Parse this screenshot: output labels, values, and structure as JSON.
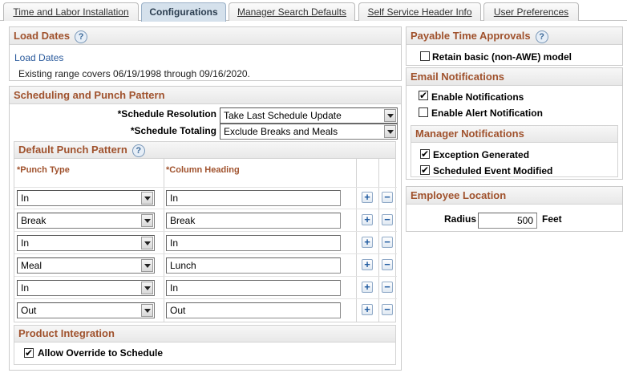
{
  "tabs": [
    {
      "label": "Time and Labor Installation",
      "active": false
    },
    {
      "label": "Configurations",
      "active": true
    },
    {
      "label": "Manager Search Defaults",
      "active": false
    },
    {
      "label": "Self Service Header Info",
      "active": false
    },
    {
      "label": "User Preferences",
      "active": false
    }
  ],
  "load_dates": {
    "title": "Load Dates",
    "link": "Load Dates",
    "range_text": "Existing range covers 06/19/1998 through 09/16/2020."
  },
  "scheduling": {
    "title": "Scheduling and Punch Pattern",
    "resolution_label": "*Schedule Resolution",
    "resolution_value": "Take Last Schedule Update",
    "totaling_label": "*Schedule Totaling",
    "totaling_value": "Exclude Breaks and Meals"
  },
  "punch_pattern": {
    "title": "Default Punch Pattern",
    "col_punch_type": "*Punch Type",
    "col_heading": "*Column Heading",
    "rows": [
      {
        "type": "In",
        "heading": "In"
      },
      {
        "type": "Break",
        "heading": "Break"
      },
      {
        "type": "In",
        "heading": "In"
      },
      {
        "type": "Meal",
        "heading": "Lunch"
      },
      {
        "type": "In",
        "heading": "In"
      },
      {
        "type": "Out",
        "heading": "Out"
      }
    ],
    "add_symbol": "+",
    "delete_symbol": "−"
  },
  "product_integration": {
    "title": "Product Integration",
    "allow_override_label": "Allow Override to Schedule",
    "allow_override_checked": true
  },
  "payable_time": {
    "title": "Payable Time Approvals",
    "retain_label": "Retain basic (non-AWE) model",
    "retain_checked": false
  },
  "email_notifications": {
    "title": "Email Notifications",
    "enable_notifications_label": "Enable Notifications",
    "enable_notifications_checked": true,
    "enable_alert_label": "Enable Alert Notification",
    "enable_alert_checked": false
  },
  "manager_notifications": {
    "title": "Manager Notifications",
    "exception_label": "Exception Generated",
    "exception_checked": true,
    "scheduled_label": "Scheduled Event Modified",
    "scheduled_checked": true
  },
  "employee_location": {
    "title": "Employee Location",
    "radius_label": "Radius",
    "radius_value": "500",
    "unit": "Feet"
  },
  "icons": {
    "help": "?",
    "check": "✔"
  },
  "colors": {
    "section_title": "#a0522d",
    "link": "#2a5a9c",
    "active_tab": "#d5e1ec"
  }
}
